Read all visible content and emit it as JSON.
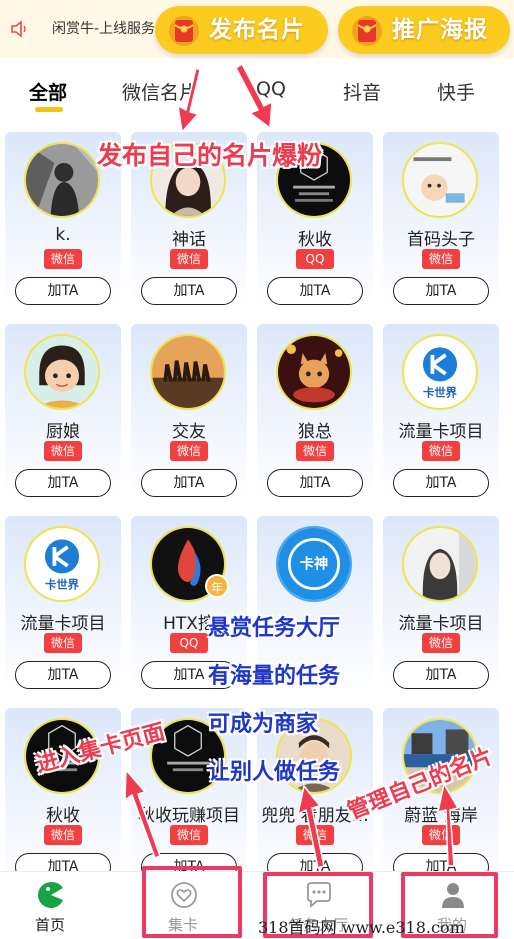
{
  "notice": {
    "text": "闲赏牛-上线服务",
    "icon": "speaker-icon"
  },
  "actions": {
    "publish_card": "发布名片",
    "promote_poster": "推广海报"
  },
  "tabs": [
    {
      "label": "全部",
      "active": true
    },
    {
      "label": "微信名片",
      "active": false
    },
    {
      "label": "QQ",
      "active": false
    },
    {
      "label": "抖音",
      "active": false
    },
    {
      "label": "快手",
      "active": false
    }
  ],
  "cards": [
    {
      "name": "k.",
      "platform": "微信",
      "button": "加TA"
    },
    {
      "name": "神话",
      "platform": "微信",
      "button": "加TA"
    },
    {
      "name": "秋收",
      "platform": "QQ",
      "button": "加TA"
    },
    {
      "name": "首码头子",
      "platform": "微信",
      "button": "加TA"
    },
    {
      "name": "厨娘",
      "platform": "微信",
      "button": "加TA"
    },
    {
      "name": "交友",
      "platform": "微信",
      "button": "加TA"
    },
    {
      "name": "狼总",
      "platform": "微信",
      "button": "加TA"
    },
    {
      "name": "流量卡项目",
      "platform": "微信",
      "button": "加TA"
    },
    {
      "name": "流量卡项目",
      "platform": "微信",
      "button": "加TA"
    },
    {
      "name": "HTX挖",
      "platform": "QQ",
      "button": "加TA",
      "year_badge": "年"
    },
    {
      "name": "",
      "platform": "",
      "button": ""
    },
    {
      "name": "流量卡项目",
      "platform": "微信",
      "button": "加TA"
    },
    {
      "name": "秋收",
      "platform": "微信",
      "button": "加TA"
    },
    {
      "name": "秋收玩赚项目",
      "platform": "微信",
      "button": "加TA"
    },
    {
      "name": "兜兜 看朋友…",
      "platform": "微信",
      "button": "加TA"
    },
    {
      "name": "蔚蓝 海岸",
      "platform": "微信",
      "button": "加TA"
    }
  ],
  "avatar_texts": {
    "kawaji": "卡世界",
    "kashen": "卡神"
  },
  "bottom_nav": [
    {
      "label": "首页",
      "icon": "home-pacman-icon",
      "active": true
    },
    {
      "label": "集卡",
      "icon": "heart-badge-icon",
      "active": false
    },
    {
      "label": "任务大厅",
      "icon": "chat-bubble-icon",
      "active": false
    },
    {
      "label": "我的",
      "icon": "user-icon",
      "active": false
    }
  ],
  "annotations": {
    "publish": "发布自己的名片爆粉",
    "task_hall_1": "悬赏任务大厅",
    "task_hall_2": "有海量的任务",
    "merchant_1": "可成为商家",
    "merchant_2": "让别人做任务",
    "collect": "进入集卡页面",
    "manage": "管理自己的名片"
  },
  "watermark": "318首码网  www.e318.com",
  "colors": {
    "accent_yellow": "#fbcb1f",
    "badge_red": "#f23f3f",
    "annotation_red": "#ef3a4f",
    "annotation_blue": "#1f36c8",
    "home_green": "#1aa346"
  }
}
